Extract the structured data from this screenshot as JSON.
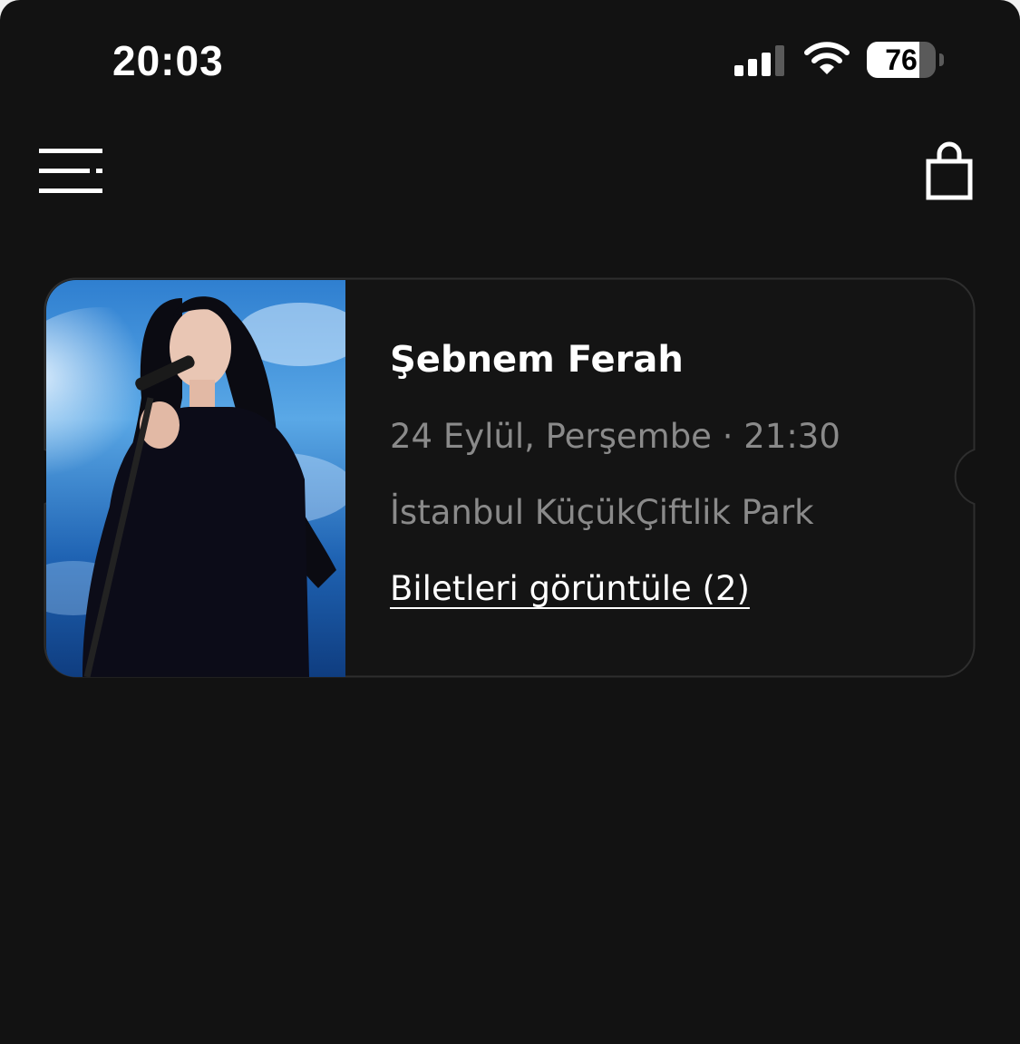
{
  "status_bar": {
    "time": "20:03",
    "battery_percent": "76",
    "battery_level": 0.76,
    "signal_bars_active": 3,
    "signal_bars_total": 4
  },
  "nav": {
    "menu_icon": "hamburger-menu-icon",
    "cart_icon": "shopping-bag-icon"
  },
  "ticket": {
    "title": "Şebnem Ferah",
    "datetime": "24 Eylül, Perşembe · 21:30",
    "venue": "İstanbul KüçükÇiftlik Park",
    "view_tickets_label": "Biletleri görüntüle (2)"
  },
  "colors": {
    "background": "#121212",
    "card_border": "#2e2e2e",
    "text_primary": "#ffffff",
    "text_secondary": "#8a8a8a"
  }
}
